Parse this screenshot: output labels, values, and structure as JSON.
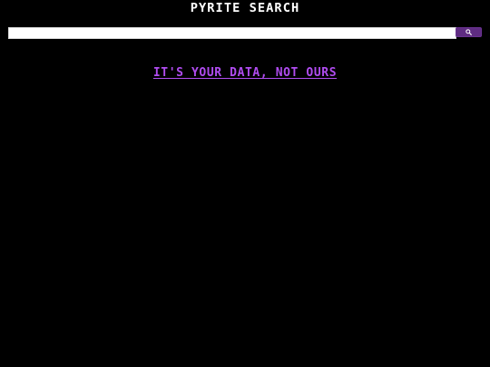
{
  "header": {
    "title": "PYRITE SEARCH"
  },
  "search": {
    "value": "",
    "placeholder": "",
    "button_icon": "search-icon"
  },
  "main": {
    "tagline": "IT'S YOUR DATA, NOT OURS"
  },
  "colors": {
    "background": "#000000",
    "title": "#ffffff",
    "tagline": "#b04cf0",
    "button": "#5f2c82"
  }
}
